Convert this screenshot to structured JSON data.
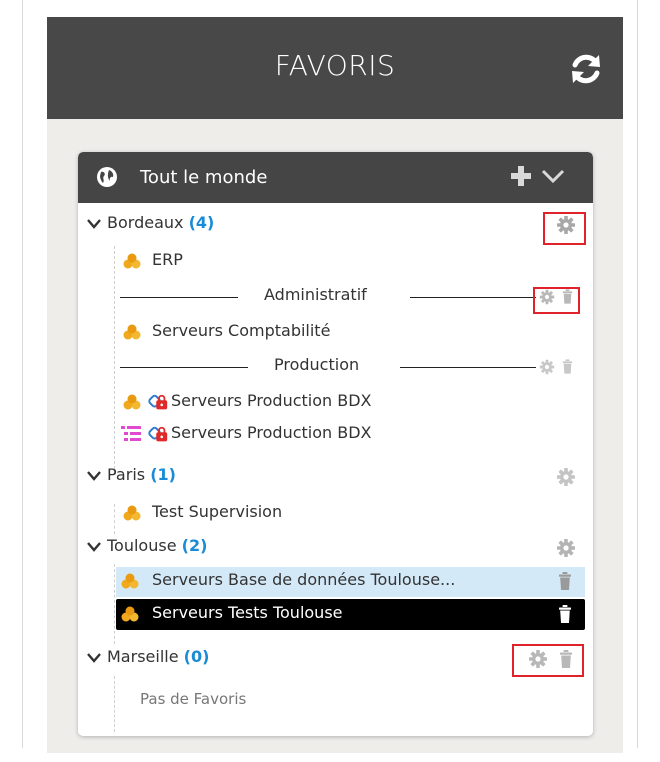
{
  "header": {
    "title": "FAVORIS",
    "refresh_icon": "refresh-icon"
  },
  "card": {
    "title": "Tout le monde",
    "globe_icon": "globe-icon",
    "add_icon": "plus-icon",
    "expand_icon": "chevron-down-icon"
  },
  "groups": {
    "bordeaux": {
      "name": "Bordeaux",
      "count": "(4)",
      "items": {
        "erp": "ERP",
        "sep1": "Administratif",
        "compta": "Serveurs Comptabilité",
        "sep2": "Production",
        "prod1": "Serveurs Production BDX",
        "prod2": "Serveurs Production BDX"
      }
    },
    "paris": {
      "name": "Paris",
      "count": "(1)",
      "items": {
        "test": "Test Supervision"
      }
    },
    "toulouse": {
      "name": "Toulouse",
      "count": "(2)",
      "items": {
        "bdd": "Serveurs Base de données Toulouse...",
        "tests": "Serveurs Tests Toulouse"
      }
    },
    "marseille": {
      "name": "Marseille",
      "count": "(0)",
      "empty": "Pas de Favoris"
    }
  },
  "colors": {
    "header_bg": "#484848",
    "panel_bg": "#eeedea",
    "count_blue": "#1a8bd6",
    "highlight_red": "#e0222a",
    "selected_light": "#d4e9f8",
    "selected_dark": "#000000"
  }
}
